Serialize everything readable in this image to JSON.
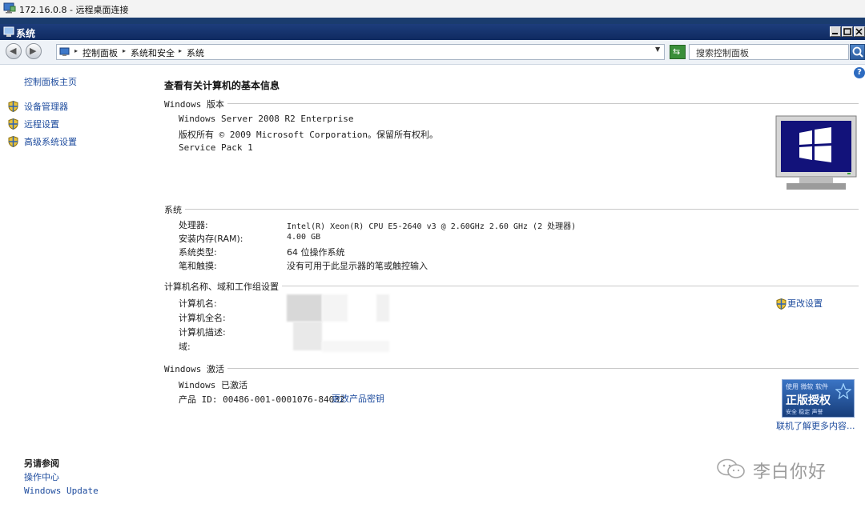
{
  "rdp": {
    "title": "172.16.0.8 - 远程桌面连接"
  },
  "window": {
    "title": "系统"
  },
  "address": {
    "crumbs": [
      "控制面板",
      "系统和安全",
      "系统"
    ],
    "search_placeholder": "搜索控制面板"
  },
  "sidebar": {
    "home": "控制面板主页",
    "items": [
      {
        "label": "设备管理器",
        "icon": "shield-icon"
      },
      {
        "label": "远程设置",
        "icon": "shield-icon"
      },
      {
        "label": "高级系统设置",
        "icon": "shield-icon"
      }
    ],
    "see_also": {
      "heading": "另请参阅",
      "links": [
        "操作中心",
        "Windows Update"
      ]
    }
  },
  "main": {
    "title": "查看有关计算机的基本信息",
    "edition": {
      "heading": "Windows 版本",
      "lines": [
        "Windows Server 2008 R2 Enterprise",
        "版权所有 © 2009 Microsoft Corporation。保留所有权利。",
        "Service Pack 1"
      ]
    },
    "system": {
      "heading": "系统",
      "rows": [
        {
          "label": "处理器:",
          "value": "Intel(R) Xeon(R) CPU E5-2640 v3 @ 2.60GHz   2.60 GHz  (2 处理器)"
        },
        {
          "label": "安装内存(RAM):",
          "value": "4.00 GB"
        },
        {
          "label": "系统类型:",
          "value": "64 位操作系统"
        },
        {
          "label": "笔和触摸:",
          "value": "没有可用于此显示器的笔或触控输入"
        }
      ]
    },
    "computer": {
      "heading": "计算机名称、域和工作组设置",
      "rows": [
        {
          "label": "计算机名:"
        },
        {
          "label": "计算机全名:"
        },
        {
          "label": "计算机描述:"
        },
        {
          "label": "域:"
        }
      ],
      "change_settings": "更改设置"
    },
    "activation": {
      "heading": "Windows 激活",
      "status": "Windows 已激活",
      "product_id_label": "产品 ID: 00486-001-0001076-84032",
      "change_key": "更改产品密钥",
      "badge": {
        "top": "使用 微软 软件",
        "main": "正版授权",
        "bottom": "安全 稳定 声誉"
      },
      "learn_more": "联机了解更多内容..."
    }
  },
  "watermark": {
    "text": "李白你好"
  }
}
